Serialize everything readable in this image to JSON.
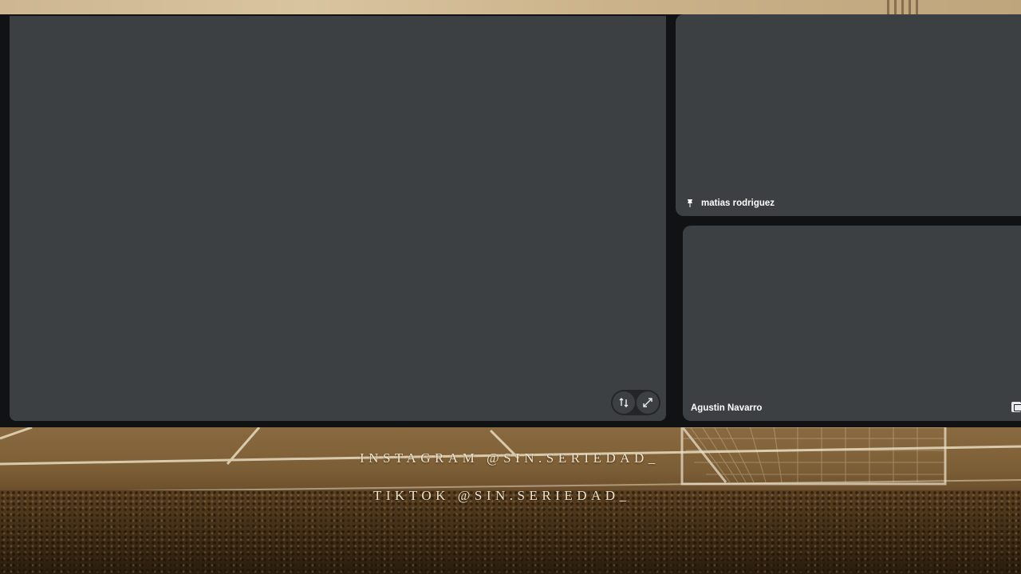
{
  "background": {
    "socials": {
      "instagram": "INSTAGRAM @SIN.SERIEDAD_",
      "tiktok": "TIKTOK @SIN.SERIEDAD_"
    }
  },
  "tiles": [
    {
      "id": "main",
      "name": ""
    },
    {
      "id": "right-top",
      "name": "matias rodriguez",
      "icon": "pin-icon"
    },
    {
      "id": "right-bottom",
      "name": "Agustin Navarro"
    }
  ],
  "controls": {
    "swap_icon": "swap-icon",
    "fullscreen_icon": "fullscreen-icon"
  },
  "colors": {
    "tile_bg": "#3c4043",
    "stage_bg": "#111213",
    "text": "#ffffff"
  }
}
